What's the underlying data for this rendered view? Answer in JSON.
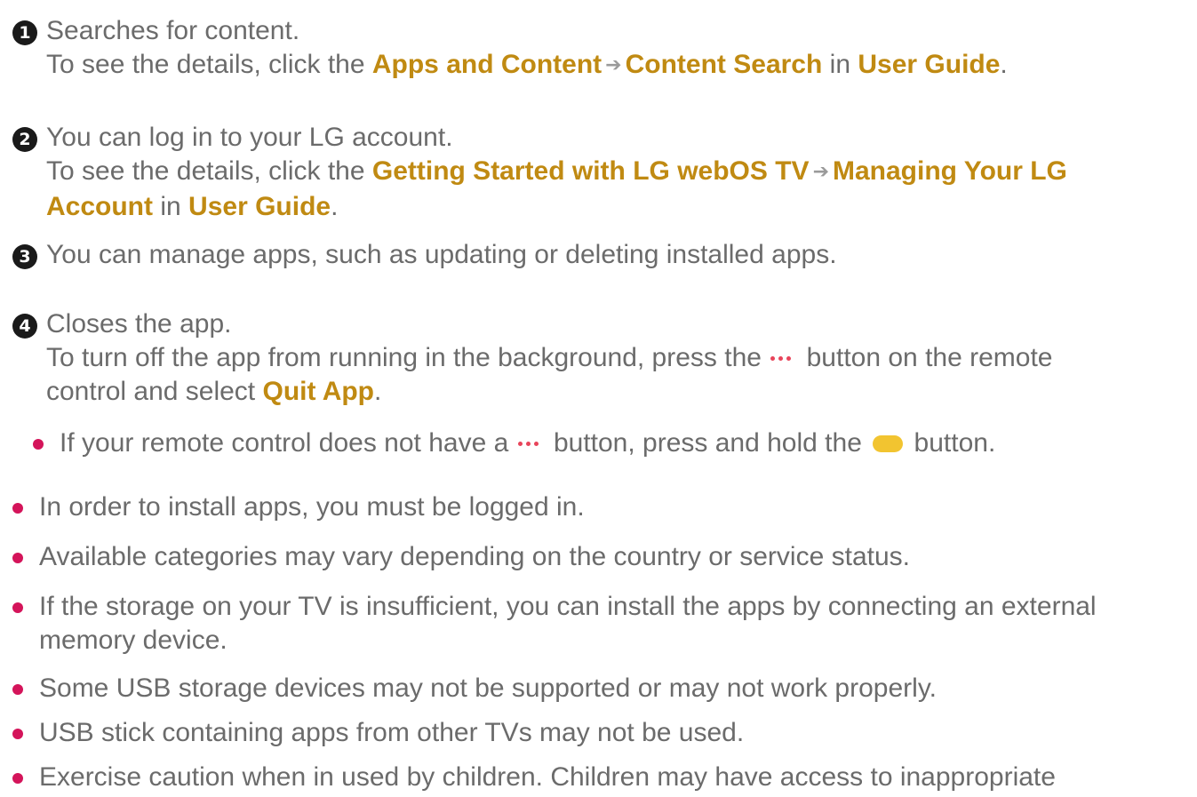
{
  "items": [
    {
      "number": "1",
      "lead": "Searches for content.",
      "detail_prefix": "To see the details, click the ",
      "link1": "Apps and Content",
      "link2": "Content Search",
      "in_word": " in ",
      "link3": "User Guide",
      "period": "."
    },
    {
      "number": "2",
      "lead": "You can log in to your LG account.",
      "detail_prefix": "To see the details, click the ",
      "link1": "Getting Started with LG webOS TV",
      "link2": "Managing Your LG",
      "link2_cont": "Account",
      "in_word": " in ",
      "link3": "User Guide",
      "period": "."
    },
    {
      "number": "3",
      "lead": "You can manage apps, such as updating or deleting installed apps."
    },
    {
      "number": "4",
      "lead": "Closes the app.",
      "detail_a": "To turn off the app from running in the background, press the ",
      "detail_b": " button on the remote",
      "detail_c": "control and select ",
      "quit_label": "Quit App",
      "period": ".",
      "sub_a": "If your remote control does not have a ",
      "sub_b": " button, press and hold the ",
      "sub_c": " button."
    }
  ],
  "notes": [
    "In order to install apps, you must be logged in.",
    "Available categories may vary depending on the country or service status.",
    "If the storage on your TV is insufficient, you can install the apps by connecting an external",
    "memory device.",
    "Some USB storage devices may not be supported or may not work properly.",
    "USB stick containing apps from other TVs may not be used.",
    "Exercise caution when in used by children. Children may have access to inappropriate"
  ],
  "arrow": "➔",
  "colors": {
    "body_text": "#6b6b6b",
    "highlight": "#c08a12",
    "bullet": "#d4145a",
    "remote_dots": "#e8445a",
    "yellow_button": "#f2c430"
  }
}
